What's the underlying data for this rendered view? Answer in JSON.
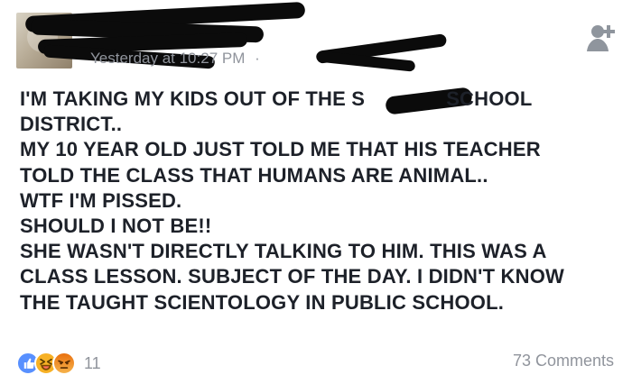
{
  "post": {
    "meta": {
      "timestamp": "Yesterday at 10:27 PM",
      "separator": "·"
    },
    "lines": [
      "I'M TAKING MY KIDS OUT OF THE S",
      "SCHOOL",
      "DISTRICT..",
      "MY 10 YEAR OLD JUST TOLD ME THAT HIS TEACHER",
      "TOLD THE CLASS THAT HUMANS ARE ANIMAL..",
      "WTF I'M PISSED.",
      "SHOULD I NOT BE!!",
      "SHE WASN'T DIRECTLY TALKING TO HIM. THIS WAS A",
      "CLASS LESSON. SUBJECT OF THE DAY. I DIDN'T KNOW",
      "THE TAUGHT SCIENTOLOGY IN PUBLIC SCHOOL."
    ]
  },
  "footer": {
    "reaction_count": "11",
    "comments_label": "73 Comments"
  },
  "icons": {
    "add_friend": "add-friend-icon",
    "like": "like-icon",
    "haha": "haha-icon",
    "angry": "angry-icon"
  },
  "colors": {
    "text": "#1d2129",
    "muted": "#90949c",
    "like": "#5890ff",
    "haha": "#f7b125",
    "angry": "#e9710f"
  }
}
